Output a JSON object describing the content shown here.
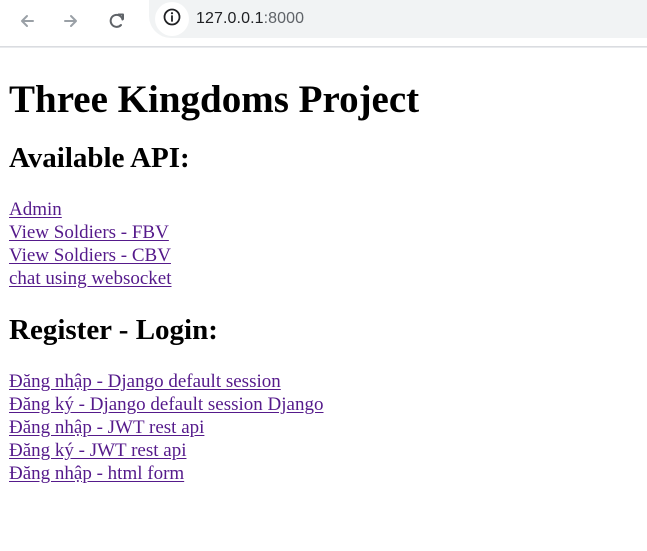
{
  "browser": {
    "url_host": "127.0.0.1",
    "url_port": ":8000",
    "icons": {
      "back": "arrow-left-icon",
      "forward": "arrow-right-icon",
      "reload": "reload-icon",
      "site_info": "info-icon"
    }
  },
  "page": {
    "title": "Three Kingdoms Project",
    "api_heading": "Available API:",
    "api_links": [
      "Admin",
      "View Soldiers - FBV",
      "View Soldiers - CBV",
      "chat using websocket"
    ],
    "auth_heading": "Register - Login:",
    "auth_links": [
      "Đăng nhập - Django default session",
      "Đăng ký - Django default session Django",
      "Đăng nhập - JWT rest api",
      "Đăng ký - JWT rest api",
      "Đăng nhập - html form"
    ]
  },
  "colors": {
    "visited_link": "#551a8b",
    "omnibox": "#f1f3f4",
    "toolbar_icon": "#5f6368"
  }
}
